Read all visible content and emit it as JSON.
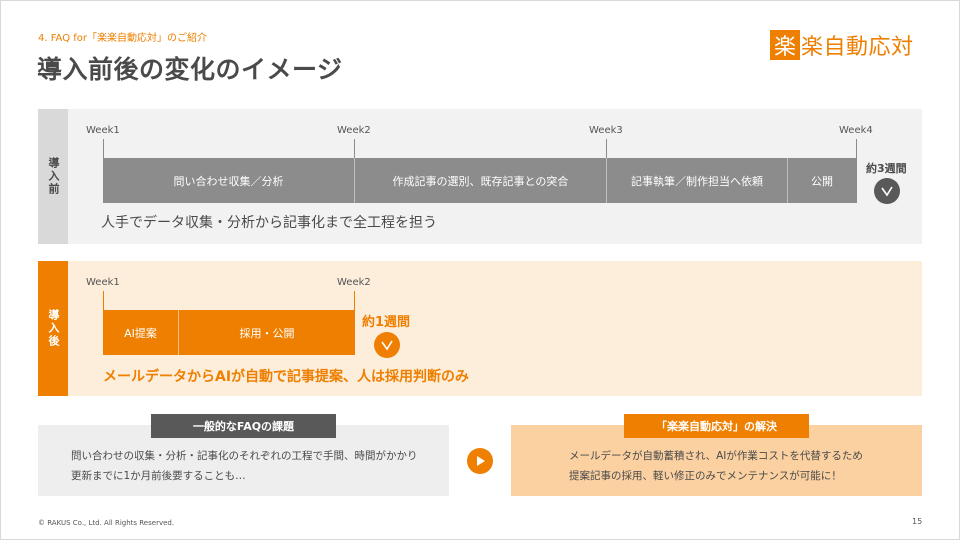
{
  "header": {
    "section_label": "4. FAQ for「楽楽自動応対」のご紹介",
    "title": "導入前後の変化のイメージ"
  },
  "logo": {
    "icon_char": "楽",
    "text": "楽自動応対",
    "color": "#ee7f00"
  },
  "before": {
    "side_label": "導入前",
    "weeks": [
      "Week1",
      "Week2",
      "Week3",
      "Week4"
    ],
    "phases": [
      "問い合わせ収集／分析",
      "作成記事の選別、既存記事との突合",
      "記事執筆／制作担当へ依頼",
      "公開"
    ],
    "duration": "約3週間",
    "check_icon": "check-icon",
    "summary": "人手でデータ収集・分析から記事化まで全工程を担う"
  },
  "after": {
    "side_label": "導入後",
    "weeks": [
      "Week1",
      "Week2"
    ],
    "phases": [
      "AI提案",
      "採用・公開"
    ],
    "duration": "約1週間",
    "check_icon": "check-icon",
    "summary": "メールデータからAIが自動で記事提案、人は採用判断のみ"
  },
  "problem": {
    "tag": "一般的なFAQの課題",
    "lines": [
      "問い合わせの収集・分析・記事化のそれぞれの工程で手間、時間がかかり",
      "更新までに1か月前後要することも…"
    ]
  },
  "solution": {
    "tag": "「楽楽自動応対」の解決",
    "lines": [
      "メールデータが自動蓄積され、AIが作業コストを代替するため",
      "提案記事の採用、軽い修正のみでメンテナンスが可能に！"
    ]
  },
  "footer": {
    "copyright": "© RAKUS Co., Ltd. All Rights Reserved.",
    "page_number": "15"
  },
  "colors": {
    "accent": "#ee7f00",
    "gray_bar": "#8c8c8c",
    "dark_gray": "#595959"
  }
}
